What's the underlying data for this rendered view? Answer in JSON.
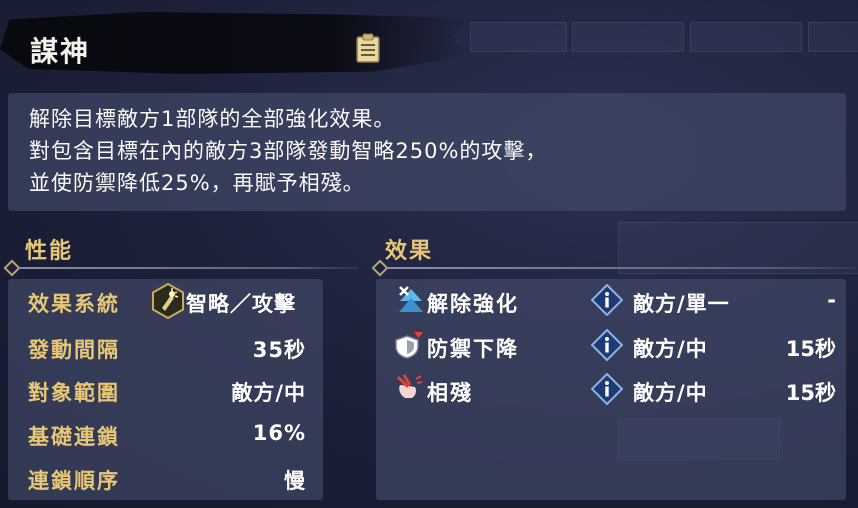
{
  "skill": {
    "name": "謀神"
  },
  "description": {
    "lines": [
      "解除目標敵方1部隊的全部強化效果。",
      "對包含目標在內的敵方3部隊發動智略250%的攻擊，",
      "並使防禦降低25%，再賦予相殘。"
    ]
  },
  "performance": {
    "title": "性能",
    "rows": [
      {
        "label": "效果系統",
        "value": "智略／攻擊",
        "icon": "strategy-attack-icon"
      },
      {
        "label": "發動間隔",
        "value": "35秒"
      },
      {
        "label": "對象範圍",
        "value": "敵方/中"
      },
      {
        "label": "基礎連鎖",
        "value": "16%"
      },
      {
        "label": "連鎖順序",
        "value": "慢"
      }
    ]
  },
  "effects": {
    "title": "效果",
    "rows": [
      {
        "icon": "buff-removal-icon",
        "name": "解除強化",
        "target": "敵方/單一",
        "duration": "-"
      },
      {
        "icon": "defense-down-icon",
        "name": "防禦下降",
        "target": "敵方/中",
        "duration": "15秒"
      },
      {
        "icon": "infighting-icon",
        "name": "相殘",
        "target": "敵方/中",
        "duration": "15秒"
      }
    ]
  },
  "colors": {
    "gold_label": "#e7c776",
    "panel": "#464e6c",
    "background": "#1c2038"
  }
}
